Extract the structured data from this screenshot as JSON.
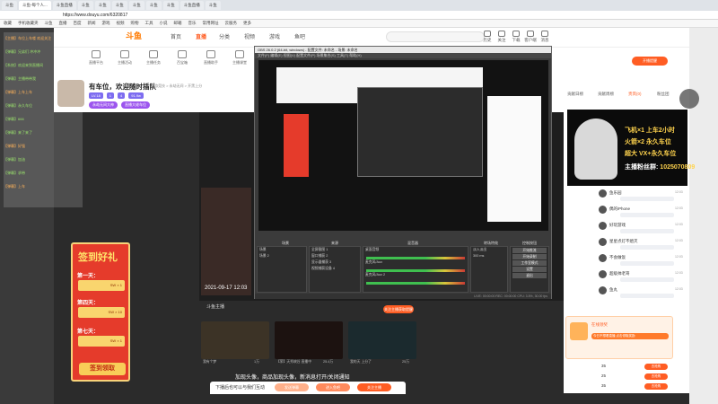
{
  "browser": {
    "tabs": [
      "斗鱼",
      "斗鱼-每个人...",
      "斗鱼直播",
      "斗鱼",
      "斗鱼",
      "斗鱼",
      "斗鱼",
      "斗鱼",
      "斗鱼",
      "斗鱼直播",
      "斗鱼"
    ],
    "active_tab": "斗鱼-每个人的直播平台",
    "url": "https://www.douyu.com/6320817",
    "bookmarks": [
      "收藏",
      "手机收藏夹",
      "斗鱼",
      "直播",
      "百度",
      "新闻",
      "游戏",
      "视频",
      "购物",
      "工具",
      "小说",
      "邮箱",
      "音乐",
      "常用网址",
      "云服务",
      "更多"
    ]
  },
  "site": {
    "logo": "斗鱼",
    "nav": [
      "首页",
      "直播",
      "分类",
      "视频",
      "游戏",
      "鱼吧"
    ],
    "active_nav": "直播",
    "header_icons": [
      "历史",
      "关注",
      "下载",
      "客户端",
      "消息"
    ]
  },
  "room": {
    "tools": [
      "直播平台",
      "主播活动",
      "主播任务",
      "百宝箱",
      "直播助手",
      "主播课堂"
    ],
    "title": "有车位，欢迎随时插队",
    "meta": "网游竞技 > 永劫无间 > 开黑上分",
    "badges": [
      "LV.18",
      "1",
      "4",
      "91.9w"
    ],
    "tags": [
      "永劫无间大神",
      "直播大佬车位"
    ]
  },
  "overlay": {
    "lines": [
      {
        "text": "【主播】车位上车喽 欢迎关注",
        "color": "orange"
      },
      {
        "text": "【弹幕】兄弟们 冲冲冲",
        "color": "green"
      },
      {
        "text": "【系统】欢迎来到直播间",
        "color": "green"
      },
      {
        "text": "【弹幕】主播带带我",
        "color": "green"
      },
      {
        "text": "【弹幕】上车上车",
        "color": "orange"
      },
      {
        "text": "【弹幕】永久车位",
        "color": "green"
      },
      {
        "text": "【弹幕】666",
        "color": "green"
      },
      {
        "text": "【弹幕】来了来了",
        "color": "green"
      },
      {
        "text": "【弹幕】好强",
        "color": "orange"
      },
      {
        "text": "【弹幕】加油",
        "color": "green"
      },
      {
        "text": "【弹幕】求带",
        "color": "green"
      },
      {
        "text": "【弹幕】上车",
        "color": "orange"
      }
    ]
  },
  "gift": {
    "title": "签到好礼",
    "days": [
      "第一天：",
      "第四天：",
      "第七天："
    ],
    "items": [
      "SW × 1",
      "SW × 10",
      "SW × 1"
    ],
    "button": "签到领取"
  },
  "obs": {
    "title": "OBS 26.0.2 (64-bit, windows) - 配置文件: 未命名 - 场景: 未命名",
    "menu": "文件(F)  编辑(E)  视图(V)  配置文件(P)  场景集合(S)  工具(T)  帮助(H)",
    "docks": [
      "场景",
      "来源",
      "混音器",
      "转场特效",
      "控制按钮"
    ],
    "scenes": [
      "场景",
      "场景 2"
    ],
    "sources": [
      "全屏截图 1",
      "窗口捕获 2",
      "显示器捕获 3",
      "视频捕获设备 4"
    ],
    "mixer": [
      "桌面音频",
      "麦克风/Aux",
      "麦克风/Aux 2"
    ],
    "transition": [
      "淡入淡出",
      "300 ms"
    ],
    "controls": [
      "开始推流",
      "开始录制",
      "工作室模式",
      "设置",
      "退出"
    ],
    "status": "LIVE: 00:00:00  REC: 00:00:00  CPU: 3.5%, 30.00 fps",
    "timestamp": "2021-09-17 12:03"
  },
  "stream": {
    "streamer": "斗鱼主播",
    "follow_button": "关注主播获取提醒",
    "thumbs": [
      {
        "title": "我有个梦",
        "count": "1万"
      },
      {
        "title": "【荣】天秀峡谷 直播中",
        "count": "25.4万"
      },
      {
        "title": "我的天 上分了",
        "count": "25万"
      }
    ],
    "notice": "加现头像，商品加现头像，新消息打开/关闭通知",
    "bottom_bar_msg": "下播后也可以与我们互动",
    "bottom_buttons": [
      "发送弹幕",
      "进入鱼吧",
      "关注主播"
    ]
  },
  "right_panel": {
    "tabs": [
      "贡献日榜",
      "贡献周榜",
      "贵宾(0)",
      "粉丝团"
    ],
    "active_tab": "贵宾(0)",
    "promo_lines": [
      "飞机×1  上车2小时",
      "火箭×2  永久车位",
      "超大 VX+永久车位"
    ],
    "promo_qq_label": "主播粉丝群:",
    "promo_qq": "1025070809",
    "chat": [
      {
        "name": "鱼乐园",
        "msg": "欢迎进入直播间",
        "time": "12:03"
      },
      {
        "name": "偶的iPhone",
        "msg": "主播好强",
        "time": "12:03"
      },
      {
        "name": "好玩游戏",
        "msg": "上车上车",
        "time": "12:03"
      },
      {
        "name": "星星点灯不熄灭",
        "msg": "来了",
        "time": "12:03"
      },
      {
        "name": "不会做饭",
        "msg": "永久车位",
        "time": "12:03"
      },
      {
        "name": "超级帅老哥",
        "msg": "主播带我",
        "time": "12:03"
      },
      {
        "name": "鱼丸",
        "msg": "666",
        "time": "12:03"
      }
    ],
    "promo2_title": "在线领奖",
    "promo2_bar": "今日不想看直播  点击领取奖励",
    "rank_buttons": [
      "去抢购",
      "去抢购",
      "去抢购"
    ],
    "rank_values": [
      "35",
      "25",
      "35"
    ],
    "top_button": "开播提醒"
  },
  "colors": {
    "accent": "#ff5d23",
    "overlay_green": "#9be36d",
    "overlay_orange": "#ffb35a",
    "gift_red": "#e53b2b",
    "promo_gold": "#ffd34d"
  }
}
